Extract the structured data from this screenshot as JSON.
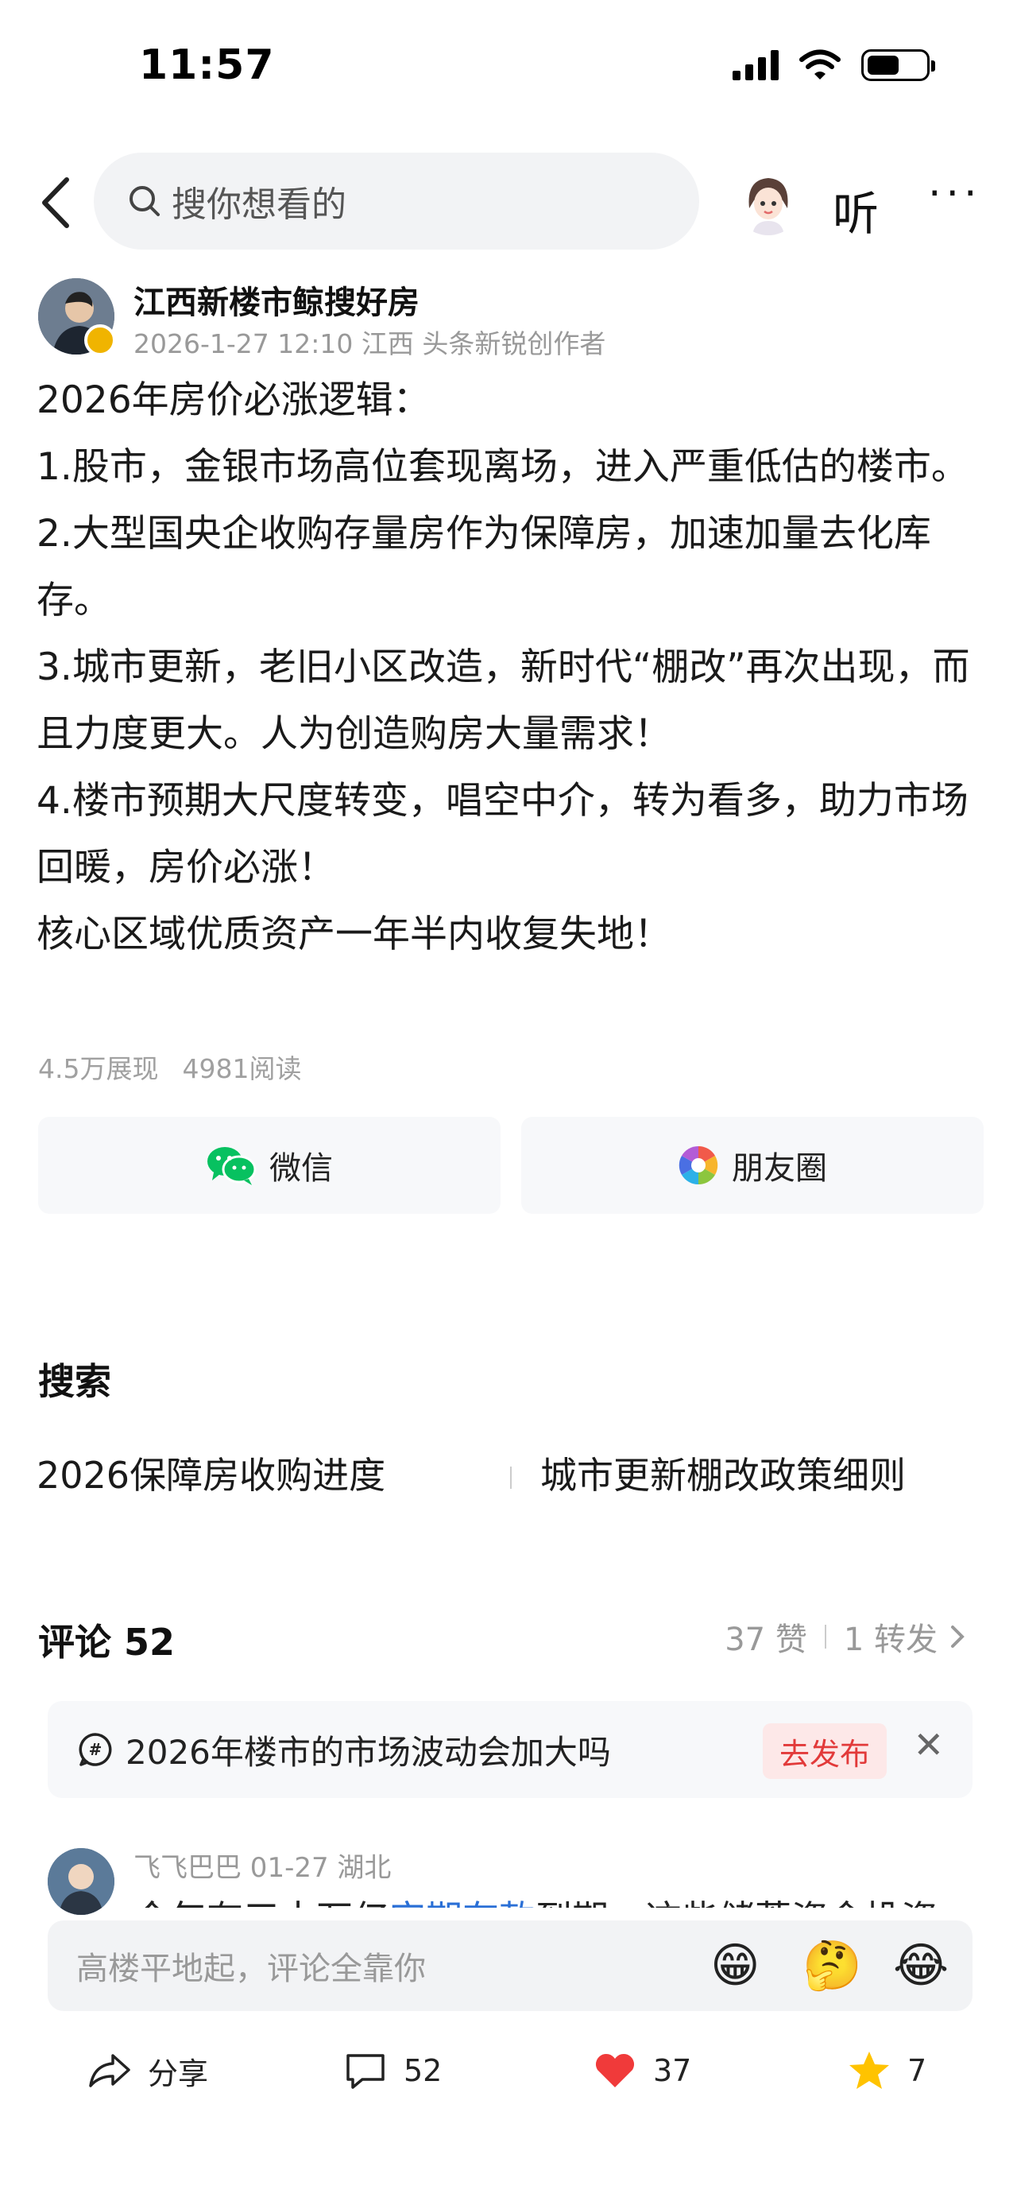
{
  "status": {
    "time": "11:57"
  },
  "search": {
    "placeholder": "搜你想看的"
  },
  "nav": {
    "listen_label": "听",
    "more_label": "···"
  },
  "author": {
    "name": "江西新楼市鲸搜好房",
    "meta": "2026-1-27 12:10  江西  头条新锐创作者"
  },
  "article": {
    "paragraphs": [
      "2026年房价必涨逻辑：",
      "1.股市，金银市场高位套现离场，进入严重低估的楼市。",
      "2.大型国央企收购存量房作为保障房，加速加量去化库存。",
      "3.城市更新，老旧小区改造，新时代“棚改”再次出现，而且力度更大。人为创造购房大量需求！",
      "4.楼市预期大尺度转变，唱空中介，转为看多，助力市场回暖，房价必涨！",
      "核心区域优质资产一年半内收复失地！"
    ]
  },
  "stats": {
    "impressions": "4.5万展现",
    "reads": "4981阅读"
  },
  "share": {
    "wechat": "微信",
    "moments": "朋友圈"
  },
  "search_section": {
    "title": "搜索",
    "tags": [
      "2026保障房收购进度",
      "城市更新棚改政策细则"
    ]
  },
  "comments": {
    "title": "评论 52",
    "likes": "37 赞",
    "reposts": "1 转发",
    "topic": "2026年楼市的市场波动会加大吗",
    "publish_label": "去发布",
    "first": {
      "meta": "飞飞巴巴  01-27  湖北",
      "text_start": "今年有三十万亿",
      "text_link": "定期存款",
      "text_end": "到期，这些储蓄资金投资"
    }
  },
  "input": {
    "placeholder": "高楼平地起，评论全靠你"
  },
  "actions": {
    "share": "分享",
    "comments": "52",
    "likes": "37",
    "favorites": "7"
  },
  "colors": {
    "accent_red": "#e23a3a",
    "link_blue": "#2a6fd6",
    "wechat_green": "#07c160",
    "star": "#ffc300",
    "heart": "#f03a3a"
  }
}
